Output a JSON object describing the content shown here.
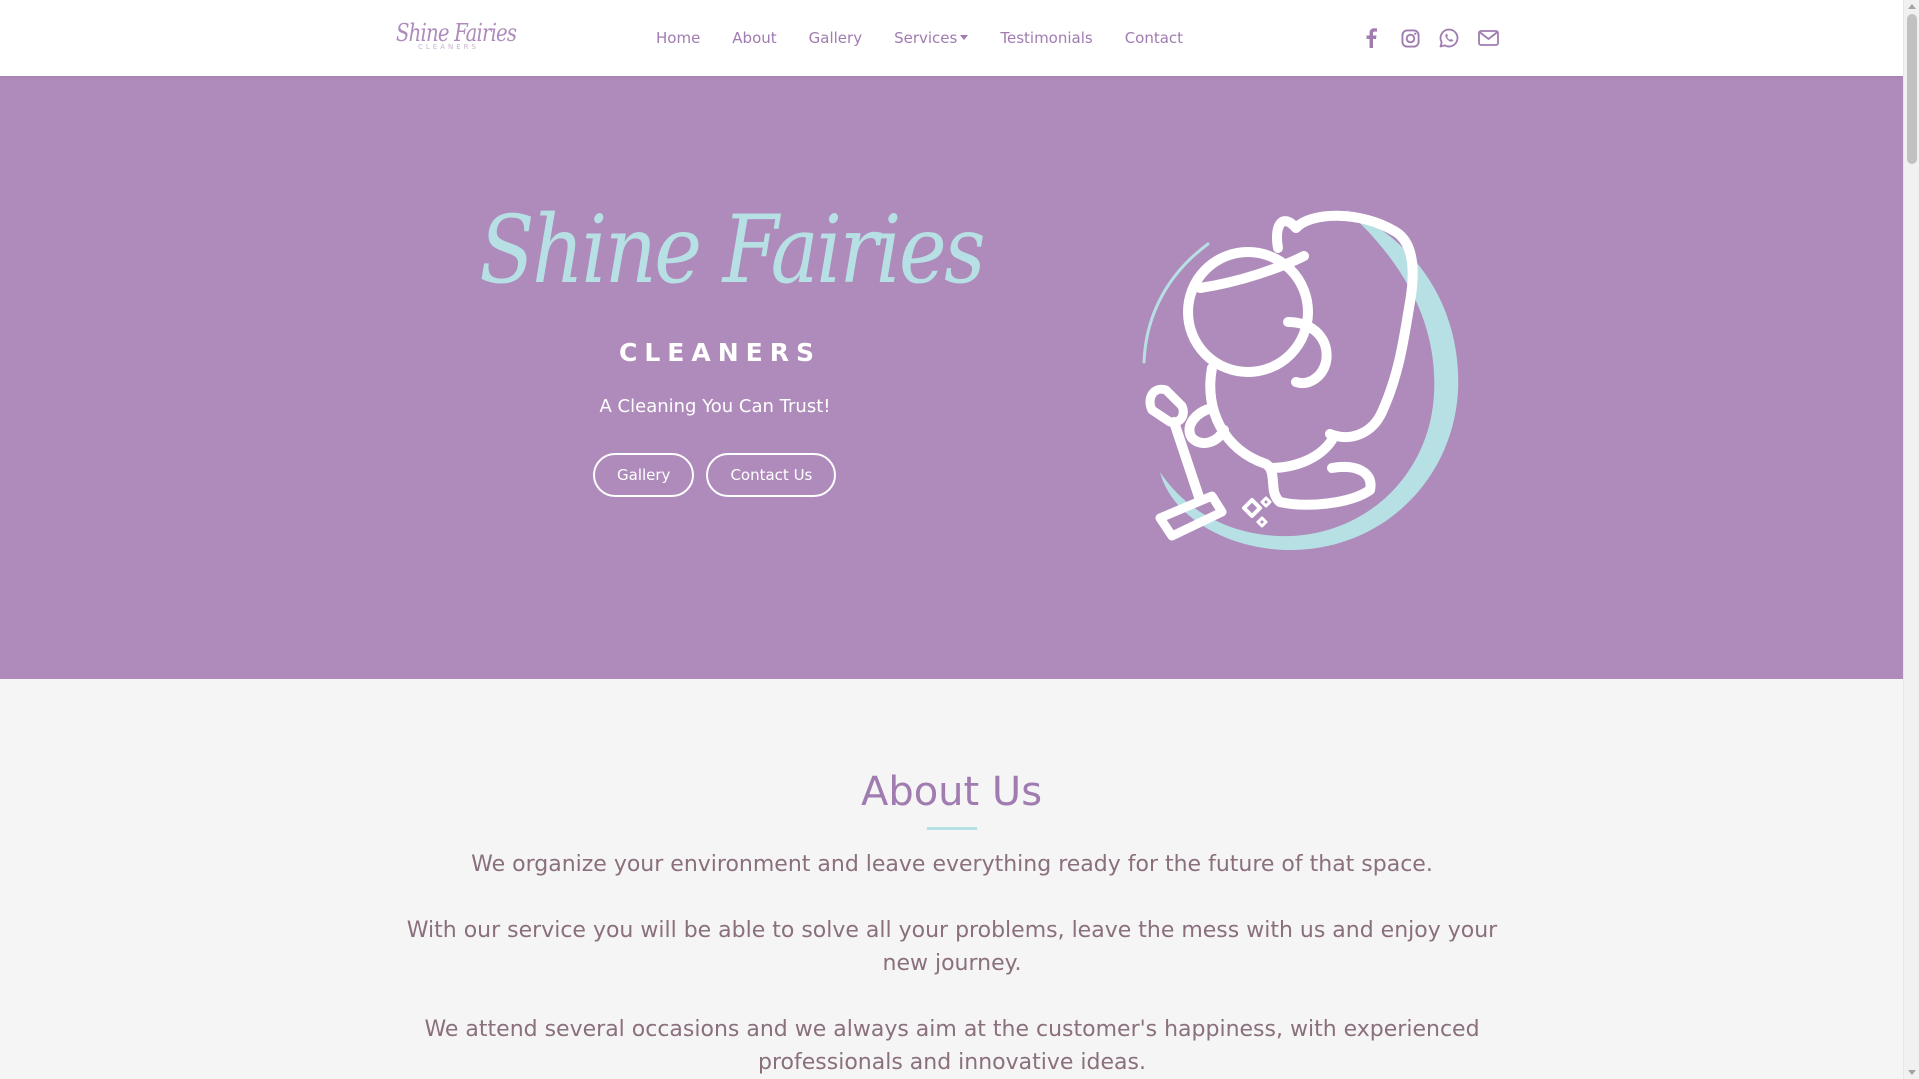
{
  "brand": {
    "name": "Shine Fairies",
    "subtitle": "CLEANERS"
  },
  "nav": {
    "items": [
      {
        "label": "Home"
      },
      {
        "label": "About"
      },
      {
        "label": "Gallery"
      },
      {
        "label": "Services",
        "has_dropdown": true
      },
      {
        "label": "Testimonials"
      },
      {
        "label": "Contact"
      }
    ]
  },
  "socials": [
    {
      "icon": "facebook-icon"
    },
    {
      "icon": "instagram-icon"
    },
    {
      "icon": "whatsapp-icon"
    },
    {
      "icon": "envelope-icon"
    }
  ],
  "hero": {
    "title": "Shine Fairies",
    "subtitle": "CLEANERS",
    "tagline": "A Cleaning You Can Trust!",
    "buttons": {
      "gallery": "Gallery",
      "contact": "Contact Us"
    },
    "logo_icon": "fairy-vacuum-logo-icon"
  },
  "about": {
    "title": "About Us",
    "paragraphs": [
      "We organize your environment and leave everything ready for the future of that space.",
      "With our service you will be able to solve all your problems, leave the mess with us and enjoy your new journey.",
      "We attend several occasions and we always aim at the customer's happiness, with experienced professionals and innovative ideas."
    ]
  },
  "colors": {
    "primary_purple": "#ae8bbb",
    "nav_text": "#a07cb0",
    "accent_teal": "#b7e0e4",
    "body_text": "#8a6f7d",
    "section_bg": "#f6f5f5"
  }
}
